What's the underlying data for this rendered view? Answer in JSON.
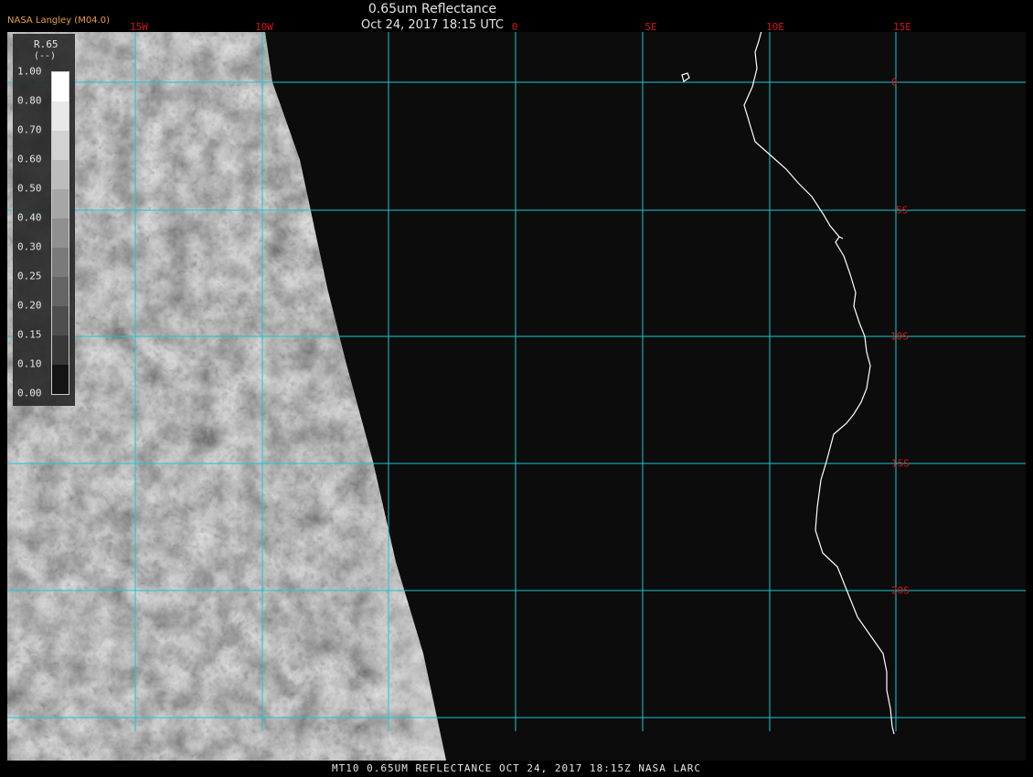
{
  "header": {
    "credit": "NASA Langley (M04.0)",
    "title": "0.65um Reflectance",
    "subtitle": "Oct 24, 2017 18:15 UTC"
  },
  "grid": {
    "longitudes": [
      {
        "label": "15W",
        "value": -15
      },
      {
        "label": "10W",
        "value": -10
      },
      {
        "label": "0",
        "value": 0
      },
      {
        "label": "5E",
        "value": 5
      },
      {
        "label": "10E",
        "value": 10
      },
      {
        "label": "15E",
        "value": 15
      }
    ],
    "latitudes": [
      {
        "label": "0",
        "value": 0
      },
      {
        "label": "5S",
        "value": -5
      },
      {
        "label": "10S",
        "value": -10
      },
      {
        "label": "15S",
        "value": -15
      },
      {
        "label": "20S",
        "value": -20
      }
    ],
    "gridline_color": "#19c8d2",
    "label_color": "#d01818"
  },
  "legend": {
    "variable": "R.65",
    "unit": "(--)",
    "ticks": [
      "1.00",
      "0.80",
      "0.70",
      "0.60",
      "0.50",
      "0.40",
      "0.30",
      "0.25",
      "0.20",
      "0.15",
      "0.10",
      "0.00"
    ]
  },
  "footer": {
    "text": "MT10  0.65UM REFLECTANCE  OCT 24, 2017 18:15Z  NASA LARC"
  },
  "colors": {
    "background": "#0c0c0c",
    "coastline": "#ffffff",
    "credit": "#e8a040"
  }
}
